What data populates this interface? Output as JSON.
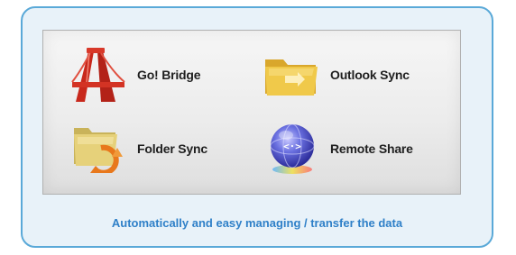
{
  "features": [
    {
      "label": "Go! Bridge",
      "icon": "bridge-icon"
    },
    {
      "label": "Outlook Sync",
      "icon": "outlook-folder-icon"
    },
    {
      "label": "Folder Sync",
      "icon": "folder-sync-icon"
    },
    {
      "label": "Remote Share",
      "icon": "remote-share-globe-icon"
    }
  ],
  "caption": "Automatically and easy managing / transfer the data",
  "colors": {
    "card_border": "#5aa9d8",
    "card_background": "#e8f2f9",
    "caption_text": "#2f80c8",
    "bridge_red": "#c8281c",
    "folder_yellow": "#e8c040",
    "globe_blue": "#5060d0"
  }
}
